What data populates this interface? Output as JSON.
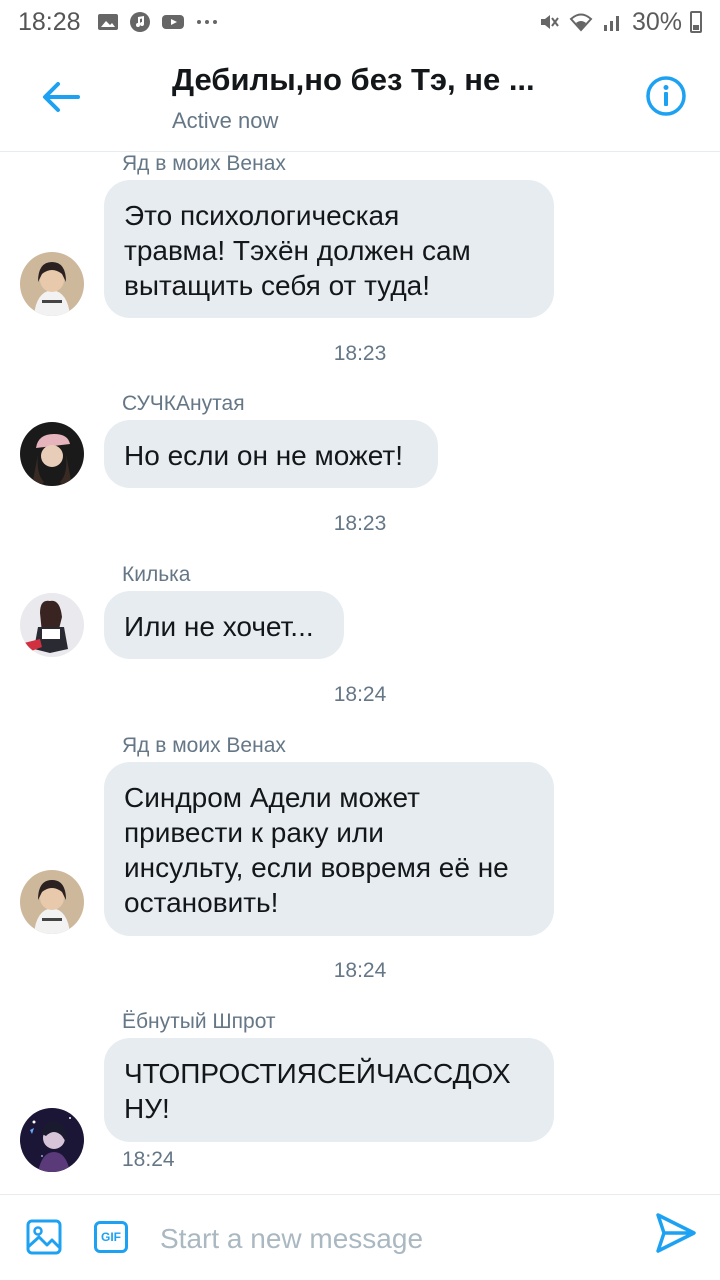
{
  "status_bar": {
    "time": "18:28",
    "battery": "30%"
  },
  "header": {
    "title": "Дебилы,но без Тэ, не ...",
    "status": "Active now"
  },
  "messages": [
    {
      "sender": "Яд в моих Венах",
      "text_lines": [
        "Это психологическая",
        "травма! Тэхён должен сам",
        "вытащить себя от туда!"
      ],
      "timestamp": "18:23"
    },
    {
      "sender": "СУЧКАнутая",
      "text_lines": [
        "Но если он не может!"
      ],
      "timestamp": "18:23"
    },
    {
      "sender": "Килька",
      "text_lines": [
        "Или не хочет..."
      ],
      "timestamp": "18:24"
    },
    {
      "sender": "Яд в моих Венах",
      "text_lines": [
        "Синдром Адели может",
        "привести к раку или",
        "инсульту, если вовремя её не",
        "остановить!"
      ],
      "timestamp": "18:24"
    },
    {
      "sender": "Ёбнутый Шпрот",
      "text_lines": [
        "ЧТОПРОСТИЯСЕЙЧАССДОХ",
        "НУ!"
      ],
      "timestamp": "18:24"
    }
  ],
  "composer": {
    "placeholder": "Start a new message",
    "gif_label": "GIF"
  },
  "colors": {
    "accent": "#1da1f2",
    "bubble": "#e6ecf0",
    "secondary_text": "#657786"
  },
  "icons": [
    "back-arrow-icon",
    "info-icon",
    "image-icon",
    "gif-icon",
    "send-icon"
  ]
}
